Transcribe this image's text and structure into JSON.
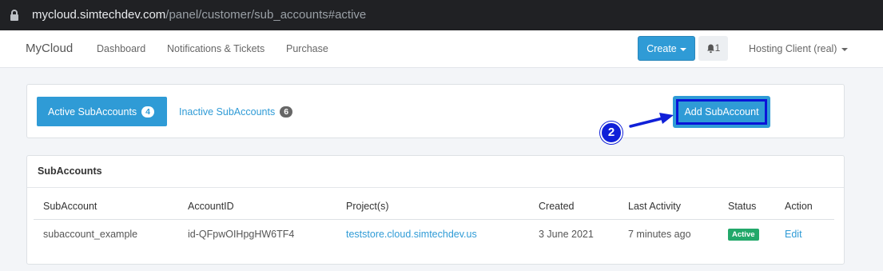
{
  "browser": {
    "url_host": "mycloud.simtechdev.com",
    "url_path": "/panel/customer/sub_accounts#active"
  },
  "navbar": {
    "brand": "MyCloud",
    "links": [
      "Dashboard",
      "Notifications & Tickets",
      "Purchase"
    ],
    "create_label": "Create",
    "notification_count": "1",
    "user_label": "Hosting Client (real)"
  },
  "tabs": {
    "active": {
      "label": "Active SubAccounts",
      "count": "4"
    },
    "inactive": {
      "label": "Inactive SubAccounts",
      "count": "6"
    },
    "add_button": "Add SubAccount"
  },
  "annotation": {
    "step": "2"
  },
  "subaccounts": {
    "title": "SubAccounts",
    "columns": [
      "SubAccount",
      "AccountID",
      "Project(s)",
      "Created",
      "Last Activity",
      "Status",
      "Action"
    ],
    "rows": [
      {
        "subaccount": "subaccount_example",
        "account_id": "id-QFpwOIHpgHW6TF4",
        "projects": "teststore.cloud.simtechdev.us",
        "created": "3 June 2021",
        "last_activity": "7 minutes ago",
        "status": "Active",
        "action": "Edit"
      }
    ]
  },
  "colors": {
    "primary": "#2f9bd6",
    "success": "#22a86a",
    "annotation": "#1020d8"
  }
}
